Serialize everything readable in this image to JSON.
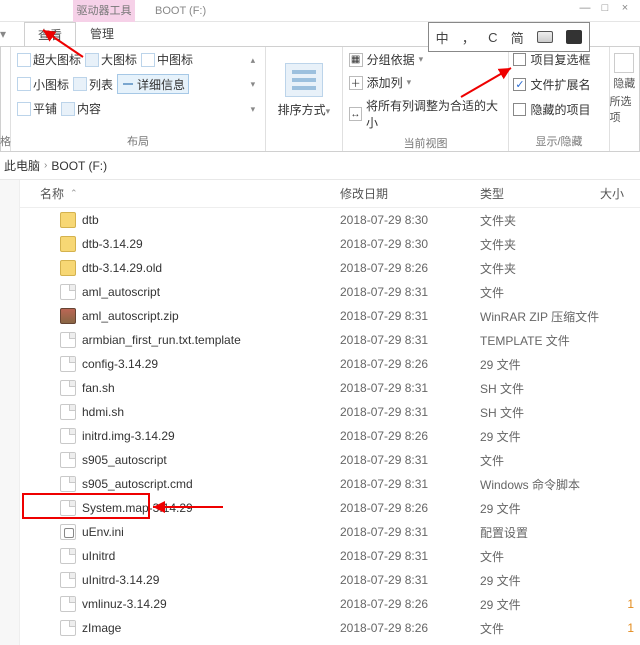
{
  "titlebar": {
    "contextual_tab": "驱动器工具",
    "drive": "BOOT (F:)",
    "win_min": "—",
    "win_max": "□",
    "win_close": "×"
  },
  "ime": {
    "zhong": "中",
    "comma": "，",
    "c": "C",
    "jian": "简"
  },
  "tabs": {
    "view": "查看",
    "manage": "管理",
    "expand": "▾"
  },
  "ribbon": {
    "layout": {
      "xl": "超大图标",
      "lg": "大图标",
      "md": "中图标",
      "sm": "小图标",
      "list": "列表",
      "detail": "详细信息",
      "tile": "平铺",
      "content": "内容",
      "caret_up": "▴",
      "caret_down": "▾",
      "label": "布局"
    },
    "sort": {
      "btn": "排序方式",
      "dd": "▾",
      "label": ""
    },
    "curview": {
      "group_by": "分组依据",
      "add_col": "添加列",
      "fit_cols": "将所有列调整为合适的大小",
      "dd": "▾",
      "label": "当前视图"
    },
    "showhide": {
      "item_chk": "项目复选框",
      "ext": "文件扩展名",
      "hidden": "隐藏的项目",
      "label": "显示/隐藏",
      "check": "✓"
    },
    "options": {
      "hide": "隐藏",
      "sel": "所选项"
    }
  },
  "crumbs": {
    "pc": "此电脑",
    "sep": "›",
    "drive": "BOOT (F:)"
  },
  "columns": {
    "name": "名称",
    "date": "修改日期",
    "type": "类型",
    "size": "大小",
    "caret": "⌃"
  },
  "files": [
    {
      "icon": "folder",
      "name": "dtb",
      "date": "2018-07-29 8:30",
      "type": "文件夹",
      "size": ""
    },
    {
      "icon": "folder",
      "name": "dtb-3.14.29",
      "date": "2018-07-29 8:30",
      "type": "文件夹",
      "size": ""
    },
    {
      "icon": "folder",
      "name": "dtb-3.14.29.old",
      "date": "2018-07-29 8:26",
      "type": "文件夹",
      "size": ""
    },
    {
      "icon": "file",
      "name": "aml_autoscript",
      "date": "2018-07-29 8:31",
      "type": "文件",
      "size": ""
    },
    {
      "icon": "zip",
      "name": "aml_autoscript.zip",
      "date": "2018-07-29 8:31",
      "type": "WinRAR ZIP 压缩文件",
      "size": ""
    },
    {
      "icon": "file",
      "name": "armbian_first_run.txt.template",
      "date": "2018-07-29 8:31",
      "type": "TEMPLATE 文件",
      "size": ""
    },
    {
      "icon": "file",
      "name": "config-3.14.29",
      "date": "2018-07-29 8:26",
      "type": "29 文件",
      "size": ""
    },
    {
      "icon": "file",
      "name": "fan.sh",
      "date": "2018-07-29 8:31",
      "type": "SH 文件",
      "size": ""
    },
    {
      "icon": "file",
      "name": "hdmi.sh",
      "date": "2018-07-29 8:31",
      "type": "SH 文件",
      "size": ""
    },
    {
      "icon": "file",
      "name": "initrd.img-3.14.29",
      "date": "2018-07-29 8:26",
      "type": "29 文件",
      "size": ""
    },
    {
      "icon": "file",
      "name": "s905_autoscript",
      "date": "2018-07-29 8:31",
      "type": "文件",
      "size": ""
    },
    {
      "icon": "file",
      "name": "s905_autoscript.cmd",
      "date": "2018-07-29 8:31",
      "type": "Windows 命令脚本",
      "size": ""
    },
    {
      "icon": "file",
      "name": "System.map-3.14.29",
      "date": "2018-07-29 8:26",
      "type": "29 文件",
      "size": ""
    },
    {
      "icon": "ini",
      "name": "uEnv.ini",
      "date": "2018-07-29 8:31",
      "type": "配置设置",
      "size": ""
    },
    {
      "icon": "file",
      "name": "uInitrd",
      "date": "2018-07-29 8:31",
      "type": "文件",
      "size": ""
    },
    {
      "icon": "file",
      "name": "uInitrd-3.14.29",
      "date": "2018-07-29 8:31",
      "type": "29 文件",
      "size": ""
    },
    {
      "icon": "file",
      "name": "vmlinuz-3.14.29",
      "date": "2018-07-29 8:26",
      "type": "29 文件",
      "size": "1"
    },
    {
      "icon": "file",
      "name": "zImage",
      "date": "2018-07-29 8:26",
      "type": "文件",
      "size": "1"
    }
  ]
}
